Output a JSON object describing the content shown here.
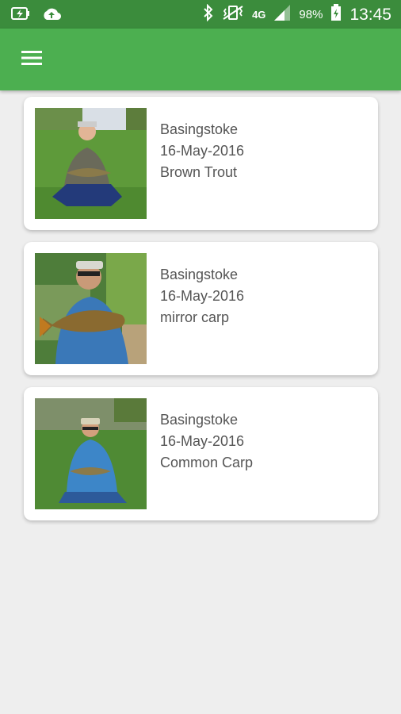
{
  "status_bar": {
    "network": "4G",
    "battery": "98%",
    "time": "13:45",
    "icons": [
      "battery-charging-icon",
      "cloud-upload-icon",
      "bluetooth-icon",
      "vibrate-icon",
      "signal-icon",
      "battery-icon"
    ]
  },
  "app_bar": {
    "menu_icon": "hamburger-menu-icon",
    "color": "#4caf50"
  },
  "catches": [
    {
      "location": "Basingstoke",
      "date": "16-May-2016",
      "species": "Brown Trout"
    },
    {
      "location": "Basingstoke",
      "date": "16-May-2016",
      "species": "mirror carp"
    },
    {
      "location": "Basingstoke",
      "date": "16-May-2016",
      "species": "Common Carp"
    }
  ]
}
